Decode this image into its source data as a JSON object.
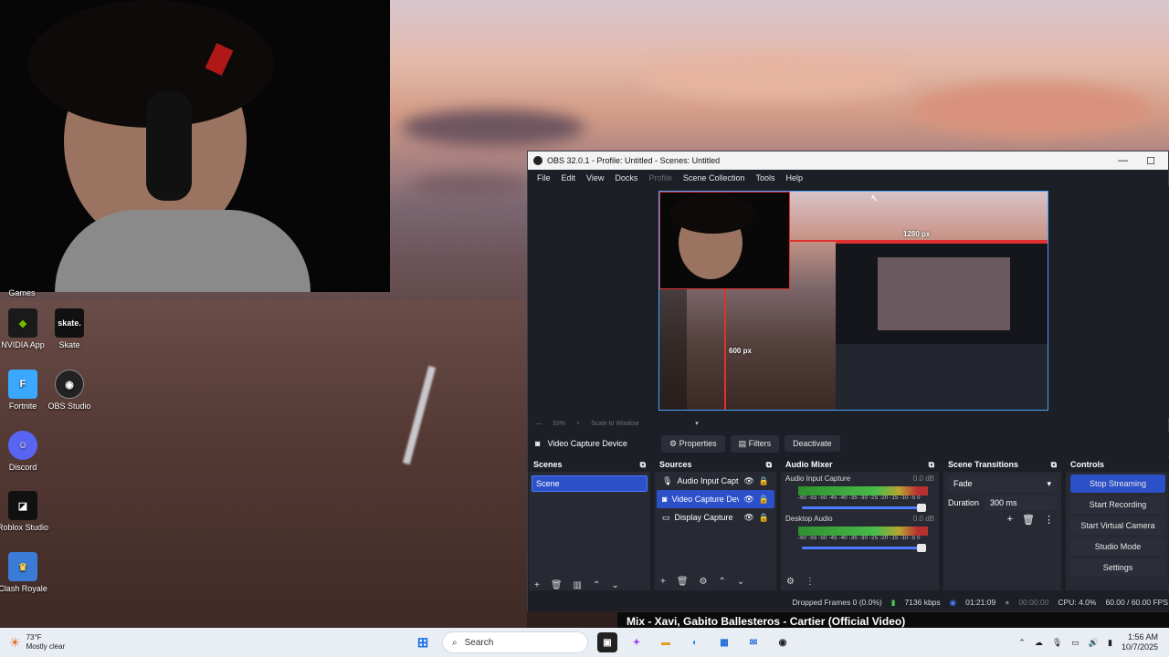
{
  "obs": {
    "title": "OBS 32.0.1 - Profile: Untitled - Scenes: Untitled",
    "menu": [
      "File",
      "Edit",
      "View",
      "Docks",
      "Profile",
      "Scene Collection",
      "Tools",
      "Help"
    ],
    "preview": {
      "width_label": "1280 px",
      "height_label": "600 px"
    },
    "zoom": {
      "percent": "33%",
      "mode": "Scale to Window"
    },
    "source_toolbar": {
      "selected_source": "Video Capture Device",
      "properties": "Properties",
      "filters": "Filters",
      "deactivate": "Deactivate"
    },
    "scenes": {
      "title": "Scenes",
      "items": [
        "Scene"
      ]
    },
    "sources": {
      "title": "Sources",
      "items": [
        {
          "name": "Audio Input Captu",
          "icon": "mic-icon"
        },
        {
          "name": "Video Capture Dev",
          "icon": "camera-icon"
        },
        {
          "name": "Display Capture",
          "icon": "monitor-icon"
        }
      ]
    },
    "mixer": {
      "title": "Audio Mixer",
      "channels": [
        {
          "name": "Audio Input Capture",
          "db": "0.0 dB"
        },
        {
          "name": "Desktop Audio",
          "db": "0.0 dB"
        }
      ],
      "scale": "-60 -55 -50 -45 -40 -35 -30 -25 -20 -15 -10 -5 0"
    },
    "transitions": {
      "title": "Scene Transitions",
      "selected": "Fade",
      "duration_label": "Duration",
      "duration_value": "300 ms"
    },
    "controls": {
      "title": "Controls",
      "buttons": [
        "Stop Streaming",
        "Start Recording",
        "Start Virtual Camera",
        "Studio Mode",
        "Settings"
      ]
    },
    "status": {
      "dropped": "Dropped Frames 0 (0.0%)",
      "bitrate": "7136 kbps",
      "stream_time": "01:21:09",
      "rec_time": "00:00:00",
      "cpu": "CPU: 4.0%",
      "fps": "60.00 / 60.00 FPS"
    }
  },
  "desktop_icons": [
    {
      "label": "Games",
      "icon": "games-icon"
    },
    {
      "label": "NVIDIA App",
      "icon": "nvidia-icon"
    },
    {
      "label": "Skate",
      "icon": "skate-icon"
    },
    {
      "label": "Fortnite",
      "icon": "fortnite-icon"
    },
    {
      "label": "OBS Studio",
      "icon": "obs-icon"
    },
    {
      "label": "Discord",
      "icon": "discord-icon"
    },
    {
      "label": "Roblox Studio",
      "icon": "roblox-icon"
    },
    {
      "label": "Clash Royale",
      "icon": "clash-royale-icon"
    }
  ],
  "music_banner": "Mix - Xavi, Gabito Ballesteros - Cartier (Official Video)",
  "taskbar": {
    "weather_temp": "73°F",
    "weather_desc": "Mostly clear",
    "search_placeholder": "Search",
    "time": "1:56 AM",
    "date": "10/7/2025"
  },
  "colors": {
    "accent": "#2c50c8",
    "dock_bg": "#272a33",
    "window_bg": "#1d1f26",
    "selection_red": "#e03030"
  }
}
